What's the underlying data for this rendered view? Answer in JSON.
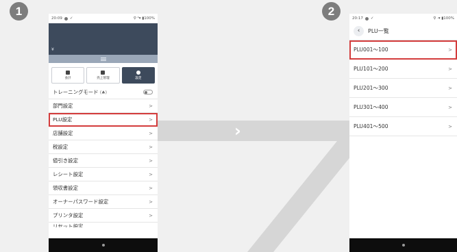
{
  "steps": [
    "1",
    "2"
  ],
  "screen1": {
    "status_time": "20:09",
    "status_right": "⚲ ⁴▾ ▮100%",
    "currency": "¥",
    "tabs": [
      {
        "label": "会計",
        "icon": "register-icon",
        "active": false
      },
      {
        "label": "売上管理",
        "icon": "sales-icon",
        "active": false
      },
      {
        "label": "設定",
        "icon": "gear-icon",
        "active": true
      }
    ],
    "training_label": "トレーニングモード",
    "rows": [
      {
        "label": "部門設定"
      },
      {
        "label": "PLU設定",
        "highlighted": true
      },
      {
        "label": "店舗設定"
      },
      {
        "label": "税設定"
      },
      {
        "label": "値引き設定"
      },
      {
        "label": "レシート設定"
      },
      {
        "label": "領収書設定"
      },
      {
        "label": "オーナーパスワード設定"
      },
      {
        "label": "プリンタ設定"
      }
    ],
    "cut_row": "リセット設定"
  },
  "screen2": {
    "status_time": "20:17",
    "status_right": "⚲ ·▾ ▮100%",
    "title": "PLU一覧",
    "rows": [
      {
        "label": "PLU001～100",
        "highlighted": true
      },
      {
        "label": "PLU101～200"
      },
      {
        "label": "PLU201～300"
      },
      {
        "label": "PLU301～400"
      },
      {
        "label": "PLU401～500"
      }
    ]
  },
  "colors": {
    "header": "#3d4a5c",
    "highlight": "#d33b3b",
    "step_badge": "#7d7d7d"
  }
}
